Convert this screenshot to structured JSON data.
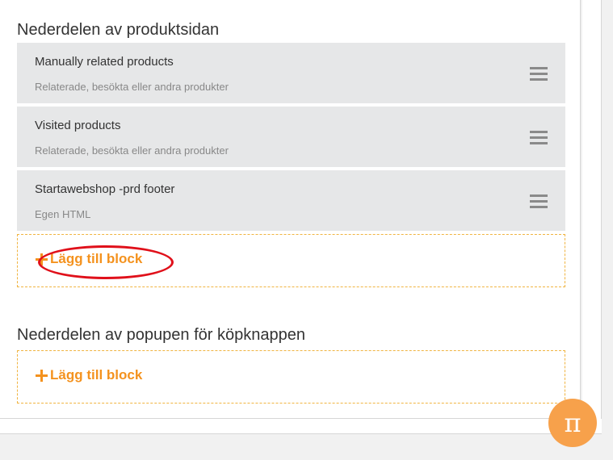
{
  "product_footer": {
    "title": "Nederdelen av produktsidan",
    "blocks": [
      {
        "name": "Manually related products",
        "type": "Relaterade, besökta eller andra produkter"
      },
      {
        "name": "Visited products",
        "type": "Relaterade, besökta eller andra produkter"
      },
      {
        "name": "Startawebshop -prd footer",
        "type": "Egen HTML"
      }
    ],
    "add_label": "Lägg till block"
  },
  "popup_footer": {
    "title": "Nederdelen av popupen för köpknappen",
    "add_label": "Lägg till block"
  },
  "fab": {
    "icon": "pi-icon",
    "symbol": "π"
  },
  "colors": {
    "accent": "#f4921e",
    "annotation": "#e0101a",
    "block_bg": "#e6e7e8"
  }
}
